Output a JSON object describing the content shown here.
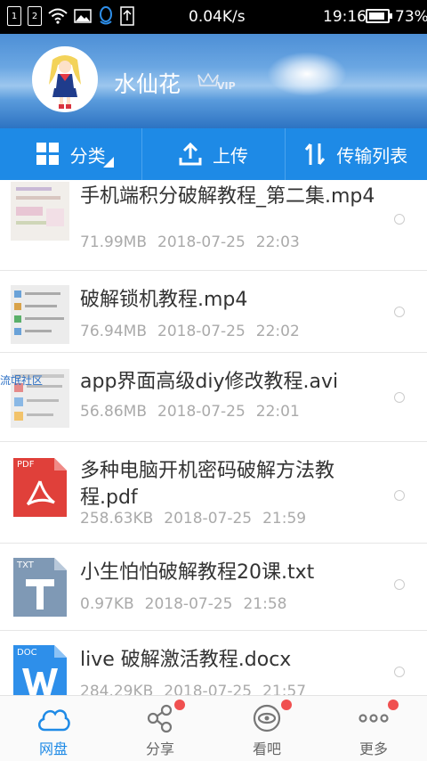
{
  "status_bar": {
    "sim1": "1",
    "sim2": "2",
    "speed": "0.04K/s",
    "time": "19:16",
    "battery": "73%",
    "battery_level": 0.73
  },
  "profile": {
    "username": "水仙花",
    "badge": "VIP"
  },
  "tabs": [
    {
      "label": "分类",
      "icon": "grid-icon"
    },
    {
      "label": "上传",
      "icon": "upload-icon"
    },
    {
      "label": "传输列表",
      "icon": "transfer-icon"
    }
  ],
  "watermark": "流氓社区",
  "files": [
    {
      "name": "手机端积分破解教程_第二集.mp4",
      "size": "71.99MB",
      "date": "2018-07-25",
      "time": "22:03",
      "type": "video"
    },
    {
      "name": "破解锁机教程.mp4",
      "size": "76.94MB",
      "date": "2018-07-25",
      "time": "22:02",
      "type": "video"
    },
    {
      "name": "app界面高级diy修改教程.avi",
      "size": "56.86MB",
      "date": "2018-07-25",
      "time": "22:01",
      "type": "video"
    },
    {
      "name": "多种电脑开机密码破解方法教程.pdf",
      "size": "258.63KB",
      "date": "2018-07-25",
      "time": "21:59",
      "type": "pdf",
      "badge": "PDF"
    },
    {
      "name": "小生怕怕破解教程20课.txt",
      "size": "0.97KB",
      "date": "2018-07-25",
      "time": "21:58",
      "type": "txt",
      "badge": "TXT"
    },
    {
      "name": "live 破解激活教程.docx",
      "size": "284.29KB",
      "date": "2018-07-25",
      "time": "21:57",
      "type": "doc",
      "badge": "DOC"
    }
  ],
  "bottom_nav": [
    {
      "label": "网盘",
      "icon": "cloud-icon",
      "active": true
    },
    {
      "label": "分享",
      "icon": "share-icon",
      "dot": true
    },
    {
      "label": "看吧",
      "icon": "eye-icon",
      "dot": true
    },
    {
      "label": "更多",
      "icon": "more-icon",
      "dot": true
    }
  ],
  "colors": {
    "accent": "#1e8ae6",
    "pdf": "#e0403a",
    "txt": "#7f99b5",
    "doc": "#2e8fea",
    "notify": "#f05050"
  }
}
